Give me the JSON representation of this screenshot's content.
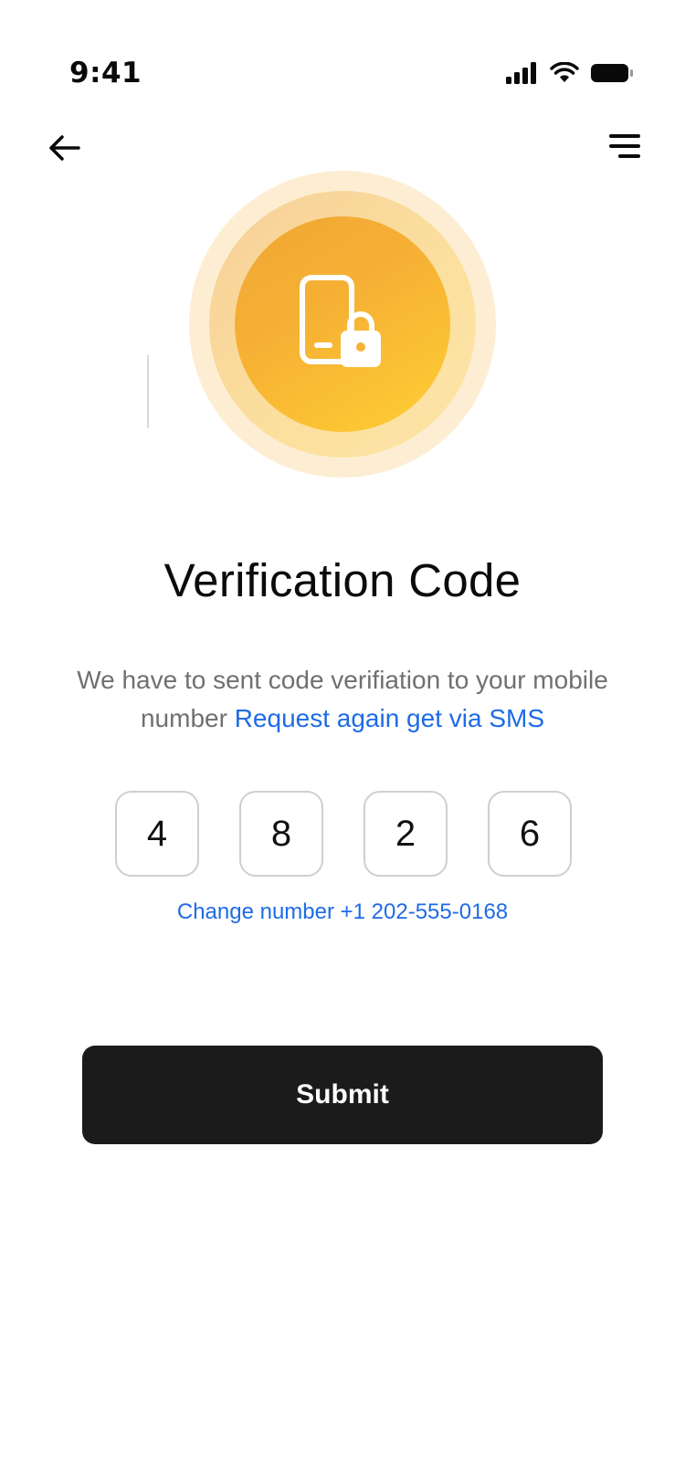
{
  "status_bar": {
    "time": "9:41",
    "icons": [
      "signal-icon",
      "wifi-icon",
      "battery-icon"
    ]
  },
  "nav": {
    "back_icon": "arrow-left-icon",
    "menu_icon": "hamburger-menu-icon"
  },
  "hero": {
    "icon": "phone-lock-icon",
    "colors": {
      "outer_ring": "#fdeed3",
      "mid_ring": "#f9d89c",
      "inner_start": "#f0a636",
      "inner_end": "#ffcf33",
      "icon": "#ffffff"
    }
  },
  "page": {
    "title": "Verification Code",
    "description_text": "We have to sent code verifiation to your mobile number",
    "request_link": "Request again get via SMS",
    "change_number_link": "Change number +1 202-555-0168"
  },
  "otp": {
    "digits": [
      "4",
      "8",
      "2",
      "6"
    ]
  },
  "actions": {
    "submit_label": "Submit"
  },
  "colors": {
    "link": "#1e6be6",
    "primary_button": "#1b1b1b",
    "text_muted": "#707070",
    "otp_border": "#cfcfcf"
  }
}
